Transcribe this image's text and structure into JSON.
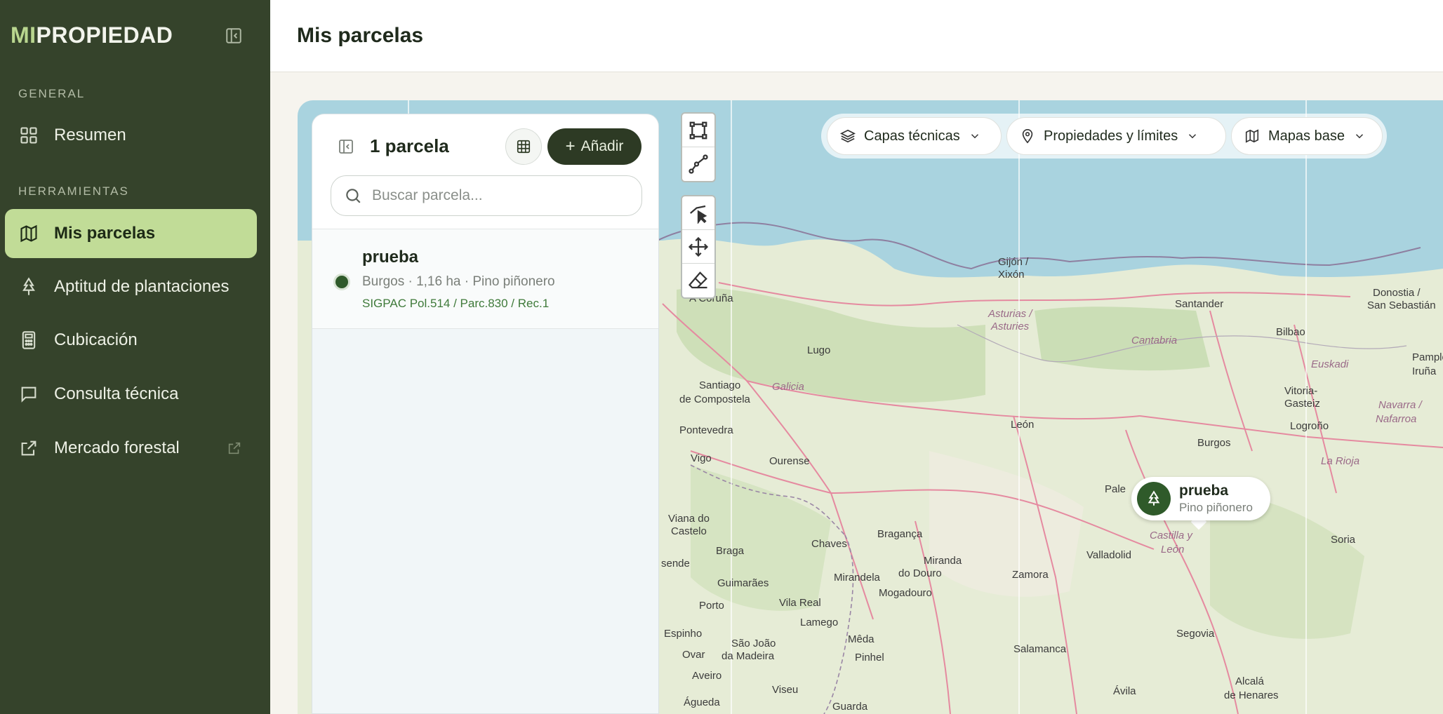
{
  "app": {
    "logo_mi": "MI",
    "logo_rest": "PROPIEDAD"
  },
  "sidebar": {
    "section_general": "GENERAL",
    "section_tools": "HERRAMIENTAS",
    "items": [
      {
        "label": "Resumen",
        "icon": "grid-icon"
      },
      {
        "label": "Mis parcelas",
        "icon": "map-icon",
        "active": true
      },
      {
        "label": "Aptitud de plantaciones",
        "icon": "tree-icon"
      },
      {
        "label": "Cubicación",
        "icon": "calculator-icon"
      },
      {
        "label": "Consulta técnica",
        "icon": "chat-icon"
      },
      {
        "label": "Mercado forestal",
        "icon": "external-link-icon"
      }
    ]
  },
  "header": {
    "title": "Mis parcelas"
  },
  "panel": {
    "count": "1 parcela",
    "add_label": "Añadir",
    "search_placeholder": "Buscar parcela...",
    "parcels": [
      {
        "name": "prueba",
        "meta": "Burgos · 1,16 ha · Pino piñonero",
        "sigpac": "SIGPAC Pol.514 / Parc.830 / Rec.1"
      }
    ]
  },
  "map_controls": {
    "layers": [
      "Capas técnicas",
      "Propiedades y límites",
      "Mapas base"
    ]
  },
  "marker": {
    "name": "prueba",
    "species": "Pino piñonero"
  },
  "map_labels": {
    "a_coruna": "A Coruña",
    "gijon": "Gijón /",
    "xixon": "Xixón",
    "asturias1": "Asturias /",
    "asturias2": "Asturies",
    "santander": "Santander",
    "cantabria": "Cantabria",
    "bilbao": "Bilbao",
    "donostia1": "Donostia /",
    "donostia2": "San Sebastián",
    "euskadi": "Euskadi",
    "pamplona1": "Pamplon",
    "pamplona2": "Iruña",
    "lugo": "Lugo",
    "santiago1": "Santiago",
    "santiago2": "de Compostela",
    "galicia": "Galicia",
    "pontevedra": "Pontevedra",
    "vigo": "Vigo",
    "ourense": "Ourense",
    "leon": "León",
    "burgos": "Burgos",
    "vitoria1": "Vitoria-",
    "vitoria2": "Gasteiz",
    "logrono": "Logroño",
    "navarra1": "Navarra /",
    "navarra2": "Nafarroa",
    "larioja": "La Rioja",
    "palencia": "Pale",
    "castilla1": "Castilla y",
    "castilla2": "León",
    "soria": "Soria",
    "viana1": "Viana do",
    "viana2": "Castelo",
    "braga": "Braga",
    "braganca": "Bragança",
    "chaves": "Chaves",
    "valladolid": "Valladolid",
    "zamora": "Zamora",
    "miranda1": "Miranda",
    "miranda2": "do Douro",
    "mirandela": "Mirandela",
    "mogadouro": "Mogadouro",
    "guimaraes": "Guimarães",
    "porto": "Porto",
    "vilareal": "Vila Real",
    "lamego": "Lamego",
    "espinho": "Espinho",
    "ovar": "Ovar",
    "saojoao1": "São João",
    "saojoao2": "da Madeira",
    "meda": "Mêda",
    "pinhel": "Pinhel",
    "aveiro": "Aveiro",
    "viseu": "Viseu",
    "guarda": "Guarda",
    "agueda": "Águeda",
    "salamanca": "Salamanca",
    "avila": "Ávila",
    "segovia": "Segovia",
    "alcala1": "Alcalá",
    "alcala2": "de Henares",
    "esende": "sende"
  }
}
